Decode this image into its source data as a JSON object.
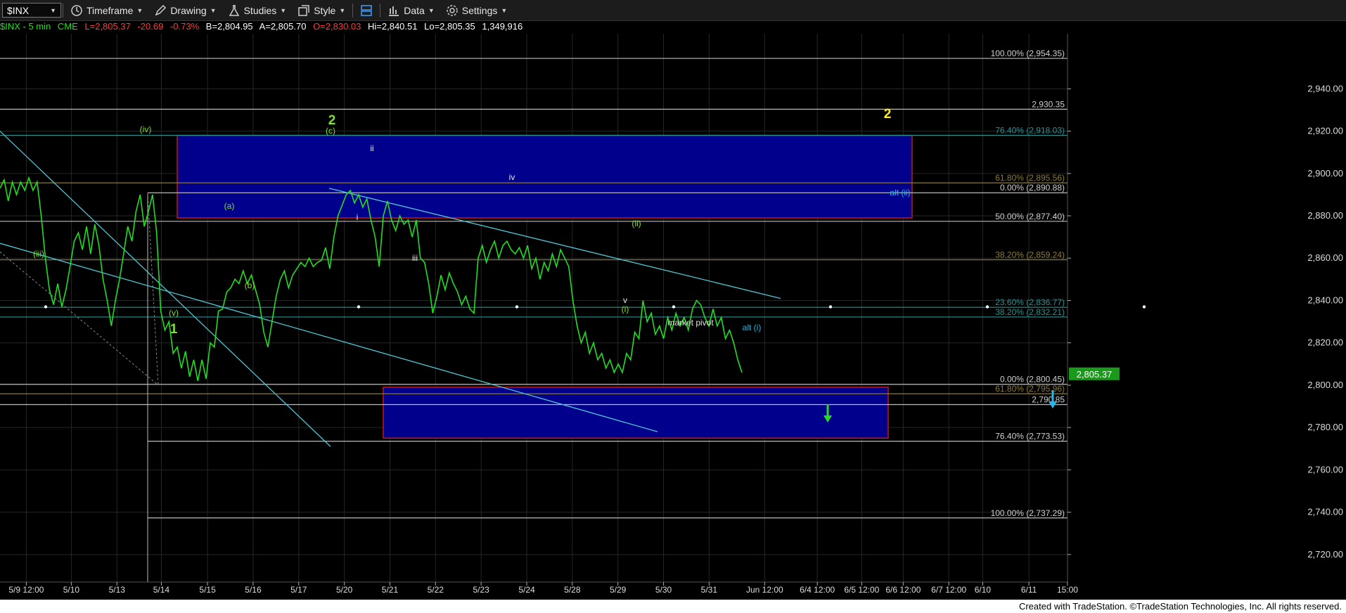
{
  "toolbar": {
    "symbol": "$INX",
    "timeframe": "Timeframe",
    "drawing": "Drawing",
    "studies": "Studies",
    "style": "Style",
    "data": "Data",
    "settings": "Settings"
  },
  "quote": {
    "symbol_label": "$INX - 5 min",
    "exchange": "CME",
    "last": "L=2,805.37",
    "change": "-20.69",
    "change_pct": "-0.73%",
    "bid": "B=2,804.95",
    "ask": "A=2,805.70",
    "open": "O=2,830.03",
    "high": "Hi=2,840.51",
    "low": "Lo=2,805.35",
    "volume": "1,349,916"
  },
  "colors": {
    "price": "#22dd22",
    "negative": "#ff3a3a",
    "channel": "#4fc7d6",
    "box_fill": "#00008c",
    "box_border": "#c01818",
    "wave_green": "#7fe030",
    "wave_yellow": "#ffee22",
    "wave_cyan": "#29b6e8",
    "grid": "#262626"
  },
  "footer": "Created with TradeStation. ©TradeStation Technologies, Inc. All rights reserved.",
  "chart_data": {
    "type": "line",
    "title": "",
    "xlabel": "",
    "ylabel": "",
    "ylim": [
      2707,
      2966
    ],
    "grid": true,
    "y_ticks": [
      2720,
      2740,
      2760,
      2780,
      2800,
      2820,
      2840,
      2860,
      2880,
      2900,
      2920,
      2940
    ],
    "x_ticks": [
      "5/9 12:00",
      "5/10",
      "5/13",
      "5/14",
      "5/15",
      "5/16",
      "5/17",
      "5/20",
      "5/21",
      "5/22",
      "5/23",
      "5/24",
      "5/28",
      "5/29",
      "5/30",
      "5/31",
      "Jun 12:00",
      "6/4 12:00",
      "6/5 12:00",
      "6/6 12:00",
      "6/7 12:00",
      "6/10",
      "6/11",
      "15:00"
    ],
    "series": [
      {
        "values": [
          2893,
          2897,
          2887,
          2896,
          2890,
          2896,
          2892,
          2898,
          2892,
          2896,
          2880,
          2860,
          2845,
          2838,
          2848,
          2837,
          2845,
          2856,
          2868,
          2872,
          2864,
          2875,
          2862,
          2876,
          2866,
          2850,
          2840,
          2828,
          2840,
          2850,
          2862,
          2875,
          2868,
          2882,
          2890,
          2875,
          2882,
          2890,
          2872,
          2835,
          2826,
          2830,
          2815,
          2818,
          2808,
          2816,
          2804,
          2812,
          2802,
          2812,
          2803,
          2820,
          2818,
          2835,
          2836,
          2844,
          2846,
          2850,
          2848,
          2854,
          2848,
          2852,
          2845,
          2838,
          2825,
          2818,
          2830,
          2842,
          2850,
          2854,
          2846,
          2852,
          2855,
          2858,
          2856,
          2860,
          2856,
          2858,
          2859,
          2865,
          2855,
          2870,
          2880,
          2885,
          2890,
          2892,
          2886,
          2890,
          2884,
          2888,
          2878,
          2870,
          2856,
          2880,
          2887,
          2878,
          2873,
          2880,
          2876,
          2878,
          2870,
          2878,
          2860,
          2858,
          2848,
          2834,
          2842,
          2852,
          2845,
          2853,
          2848,
          2844,
          2838,
          2842,
          2836,
          2834,
          2860,
          2866,
          2858,
          2864,
          2868,
          2860,
          2866,
          2868,
          2864,
          2862,
          2865,
          2860,
          2866,
          2855,
          2860,
          2850,
          2858,
          2854,
          2862,
          2856,
          2864,
          2860,
          2856,
          2840,
          2828,
          2820,
          2825,
          2815,
          2820,
          2812,
          2815,
          2808,
          2812,
          2806,
          2810,
          2806,
          2815,
          2812,
          2825,
          2822,
          2840,
          2830,
          2834,
          2824,
          2828,
          2822,
          2832,
          2826,
          2834,
          2828,
          2832,
          2826,
          2836,
          2840,
          2838,
          2832,
          2828,
          2836,
          2828,
          2832,
          2822,
          2826,
          2820,
          2812,
          2806
        ],
        "x_start": "5/8",
        "x_end": "5/29"
      }
    ],
    "horizontal_levels": [
      {
        "label": "100.00% (2,954.35)",
        "value": 2954.35
      },
      {
        "label": "2,930.35",
        "value": 2930.35
      },
      {
        "label": "76.40% (2,918.03)",
        "value": 2918.03
      },
      {
        "label": "61.80% (2,895.56)",
        "value": 2895.56
      },
      {
        "label": "0.00% (2,890.88)",
        "value": 2890.88
      },
      {
        "label": "50.00% (2,877.40)",
        "value": 2877.4
      },
      {
        "label": "38.20% (2,859.24)",
        "value": 2859.24
      },
      {
        "label": "23.60% (2,836.77)",
        "value": 2836.77
      },
      {
        "label": "38.20% (2,832.21)",
        "value": 2832.21
      },
      {
        "label": "0.00% (2,800.45)",
        "value": 2800.45
      },
      {
        "label": "61.80% (2,795.96)",
        "value": 2795.96
      },
      {
        "label": "2,790.85",
        "value": 2790.85
      },
      {
        "label": "76.40% (2,773.53)",
        "value": 2773.53
      },
      {
        "label": "100.00% (2,737.29)",
        "value": 2737.29
      }
    ],
    "last_price_tag": "2,805.37",
    "zones": [
      {
        "x_from": "5/14",
        "x_to": "5/31",
        "y_from": 2879,
        "y_to": 2918
      },
      {
        "x_from": "5/17",
        "x_to": "5/31",
        "y_from": 2775,
        "y_to": 2799
      }
    ],
    "wave_labels": [
      {
        "text": "2",
        "style": "big-green",
        "x": "5/16",
        "y": 2905
      },
      {
        "text": "(c)",
        "style": "green",
        "x": "5/16",
        "y": 2898
      },
      {
        "text": "(iv)",
        "style": "green",
        "x": "5/13",
        "y": 2899
      },
      {
        "text": "ii",
        "style": "white",
        "x": "5/17",
        "y": 2888
      },
      {
        "text": "iv",
        "style": "white",
        "x": "5/22",
        "y": 2868
      },
      {
        "text": "(a)",
        "style": "green",
        "x": "5/15",
        "y": 2855
      },
      {
        "text": "i",
        "style": "white",
        "x": "5/17",
        "y": 2848
      },
      {
        "text": "(iii)",
        "style": "green",
        "x": "5/9",
        "y": 2829
      },
      {
        "text": "iii",
        "style": "white",
        "x": "5/20",
        "y": 2826
      },
      {
        "text": "(ii)",
        "style": "green",
        "x": "5/24",
        "y": 2844
      },
      {
        "text": "(b)",
        "style": "green",
        "x": "5/15",
        "y": 2815
      },
      {
        "text": "v",
        "style": "white",
        "x": "5/24",
        "y": 2809
      },
      {
        "text": "(i)",
        "style": "green",
        "x": "5/24",
        "y": 2804
      },
      {
        "text": "(v)",
        "style": "green",
        "x": "5/13",
        "y": 2802
      },
      {
        "text": "1",
        "style": "big-green",
        "x": "5/13",
        "y": 2792
      },
      {
        "text": "2",
        "style": "big-yellow",
        "x": "5/31",
        "y": 2906
      },
      {
        "text": "alt (ii)",
        "style": "cyan",
        "x": "5/31",
        "y": 2860
      },
      {
        "text": "alt (i)",
        "style": "cyan",
        "x": "5/28",
        "y": 2792
      },
      {
        "text": "market pivot",
        "style": "pivot",
        "x": "5/24",
        "y": 2794
      }
    ],
    "arrows": [
      {
        "color": "green",
        "direction": "down",
        "x": "5/30"
      },
      {
        "color": "cyan",
        "direction": "down",
        "x": "6/5"
      }
    ]
  }
}
